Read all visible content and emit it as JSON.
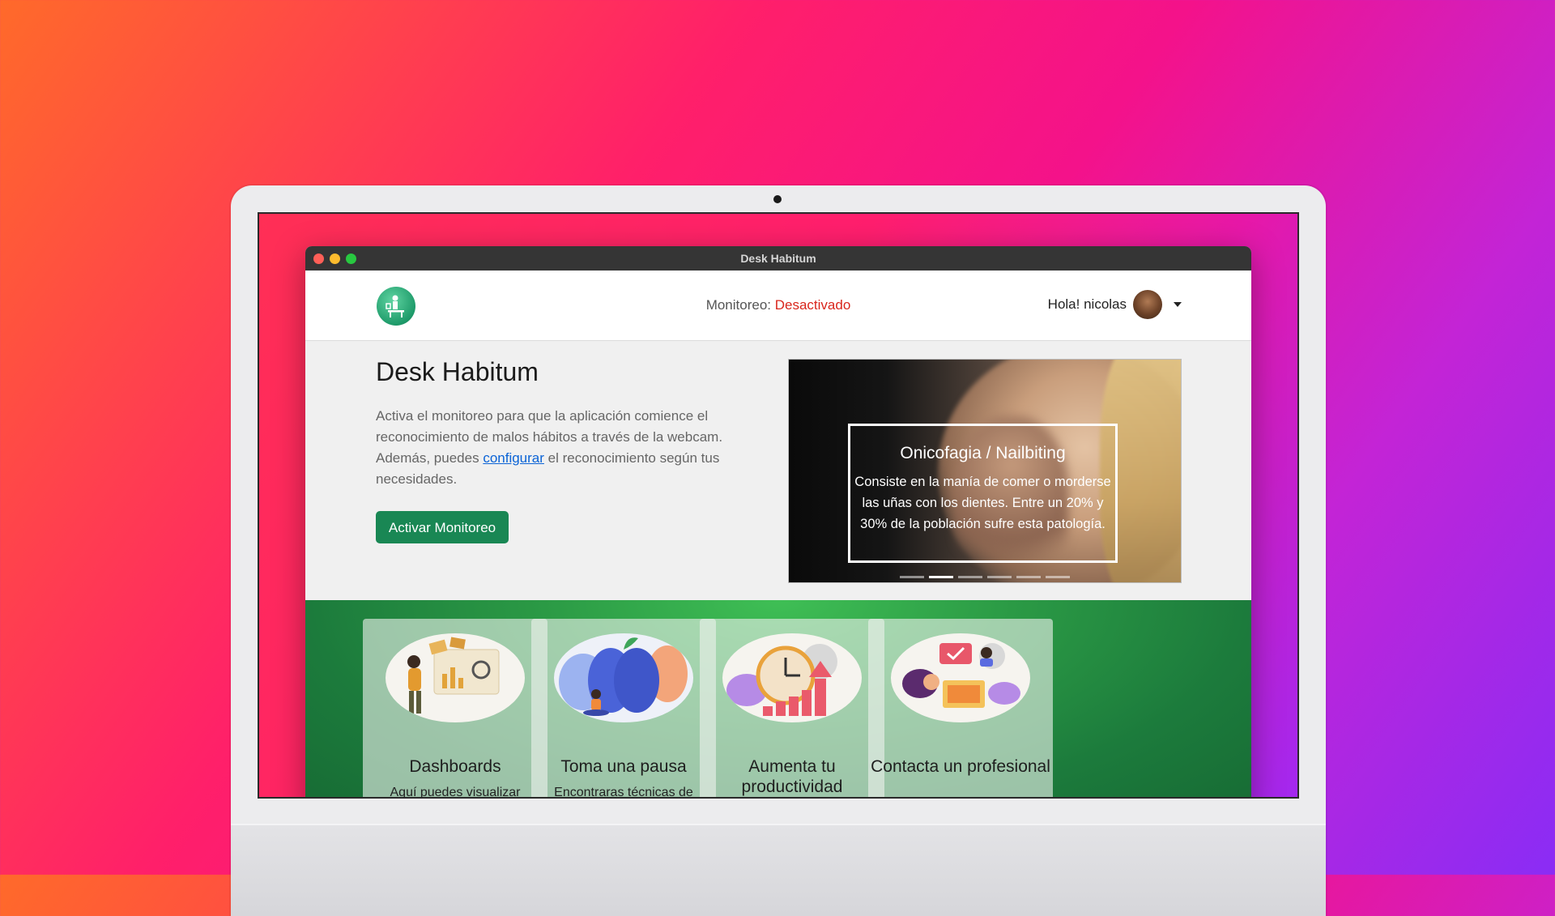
{
  "window": {
    "title": "Desk Habitum"
  },
  "navbar": {
    "monitor_label": "Monitoreo:",
    "monitor_status": "Desactivado",
    "greeting": "Hola! nicolas"
  },
  "hero": {
    "title": "Desk Habitum",
    "description_part1": "Activa el monitoreo para que la aplicación comience el reconocimiento de malos hábitos a través de la webcam. Además, puedes ",
    "description_link": "configurar",
    "description_part2": " el reconocimiento según tus necesidades.",
    "button_label": "Activar Monitoreo"
  },
  "carousel": {
    "caption_title": "Onicofagia / Nailbiting",
    "caption_text": "Consiste en la manía de comer o morderse las uñas con los dientes. Entre un 20% y 30% de la población sufre esta patología.",
    "slide_count": 6,
    "active_index": 1
  },
  "cards": [
    {
      "title": "Dashboards",
      "text": "Aquí puedes visualizar",
      "icon": "dashboard-illustration"
    },
    {
      "title": "Toma una pausa",
      "text": "Encontraras técnicas de",
      "icon": "meditation-brain-illustration"
    },
    {
      "title": "Aumenta tu productividad",
      "text": "",
      "icon": "productivity-clock-illustration"
    },
    {
      "title": "Contacta un profesional",
      "text": "",
      "icon": "contact-professional-illustration"
    }
  ],
  "colors": {
    "status_off": "#d9261c",
    "button_bg": "#198754",
    "band_green": "#2b9a45",
    "link": "#0b63d6"
  }
}
